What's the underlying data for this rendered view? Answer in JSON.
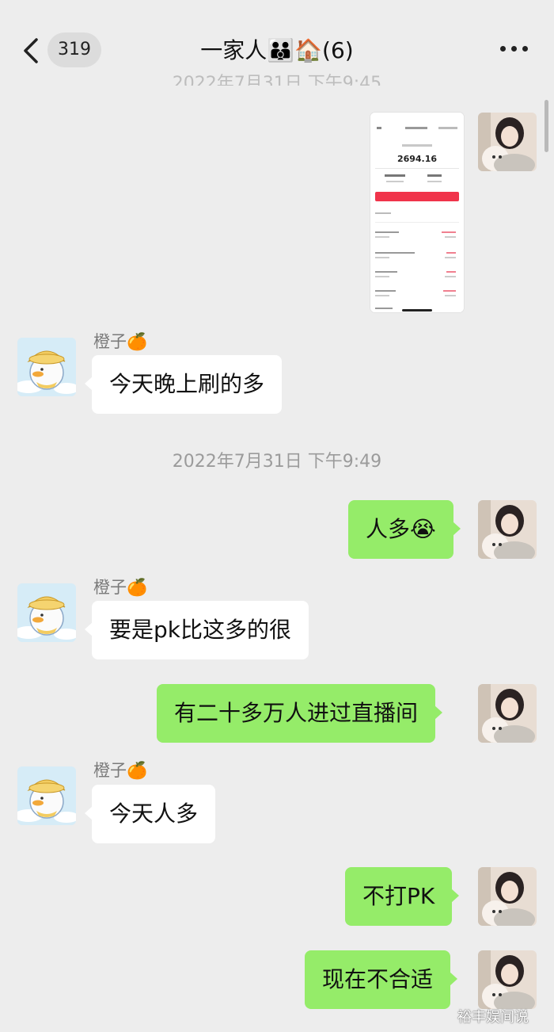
{
  "header": {
    "unread_count": "319",
    "title": "一家人👪🏠(6)",
    "partial_timestamp": "2022年7月31日 下午9:45"
  },
  "messages": {
    "m1_sender": "橙子🍊",
    "m1_text": "今天晚上刷的多",
    "timestamp": "2022年7月31日 下午9:49",
    "m2_text": "人多😭",
    "m3_sender": "橙子🍊",
    "m3_text": "要是pk比这多的很",
    "m4_text": "有二十多万人进过直播间",
    "m5_sender": "橙子🍊",
    "m5_text": "今天人多",
    "m6_text": "不打PK",
    "m7_text": "现在不合适"
  },
  "shared_image": {
    "amount": "2694.16"
  },
  "watermark": "裕丰娱间说",
  "colors": {
    "background": "#ededed",
    "self_bubble": "#95ec69",
    "other_bubble": "#ffffff"
  },
  "icons": [
    "back-chevron-icon",
    "more-dots-icon"
  ]
}
